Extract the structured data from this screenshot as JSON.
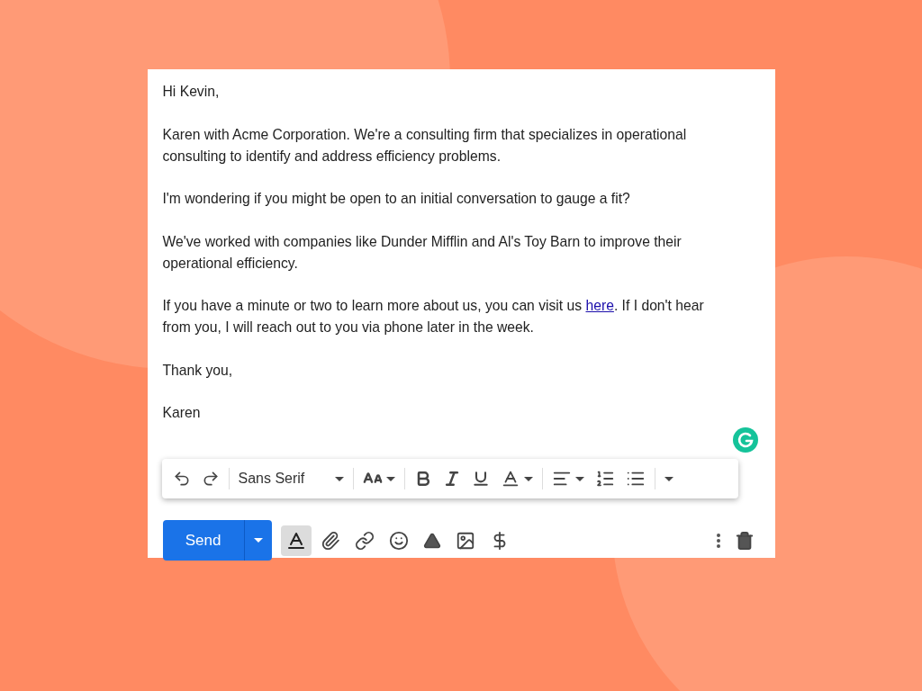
{
  "email": {
    "paragraphs": [
      {
        "text": "Hi Kevin,"
      },
      {
        "text": "Karen with Acme Corporation. We're a consulting firm that specializes in operational consulting to identify and address efficiency problems."
      },
      {
        "text": "I'm wondering if you might be open to an initial conversation to gauge a fit?"
      },
      {
        "text": "We've worked with companies like Dunder Mifflin and Al's Toy Barn to improve their operational efficiency."
      },
      {
        "text": "If you have a minute or two to learn more about us, you can visit us ",
        "link": "here",
        "after": ". If I don't hear from you, I will reach out to you via phone later in the week."
      },
      {
        "text": "Thank you,"
      },
      {
        "text": "Karen"
      }
    ]
  },
  "format_toolbar": {
    "font": "Sans Serif"
  },
  "compose_bar": {
    "send": "Send",
    "formatting_selected": true
  }
}
